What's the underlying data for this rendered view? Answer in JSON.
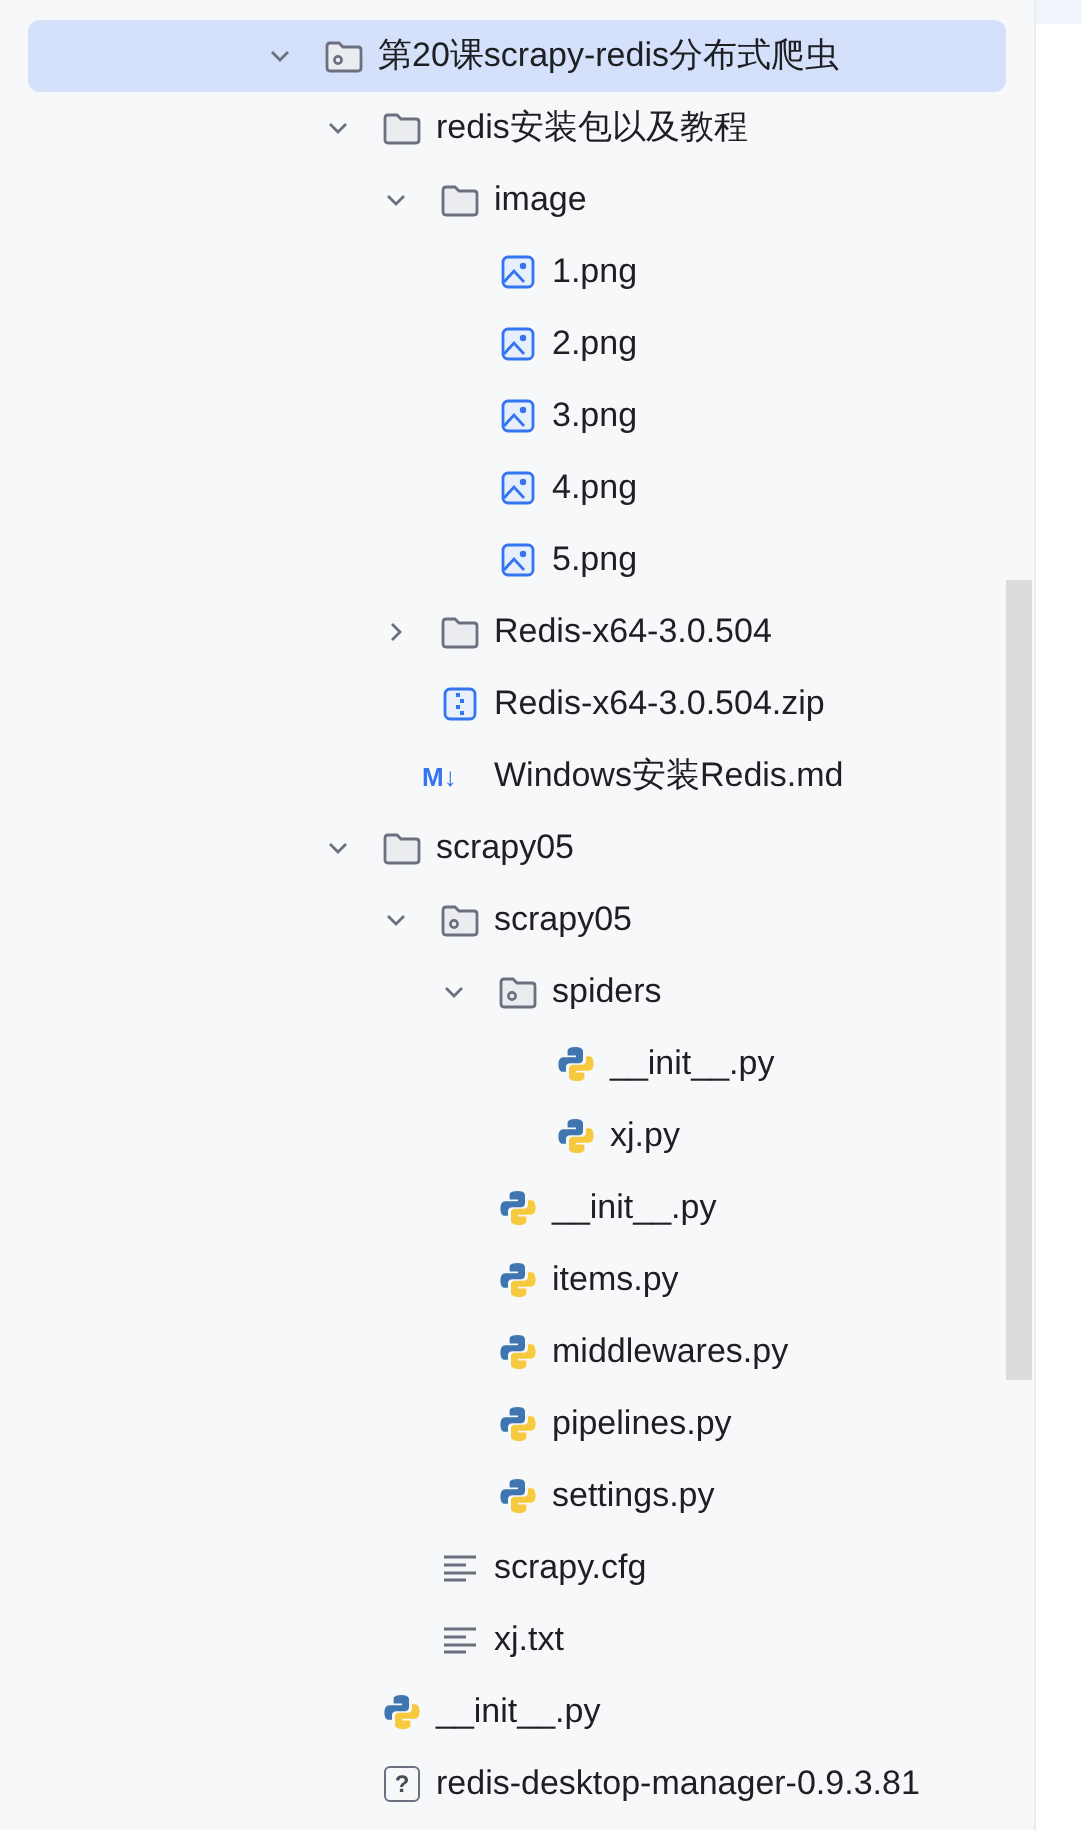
{
  "tree": [
    {
      "label": "第20课scrapy-redis分布式爬虫",
      "kind": "package",
      "selected": true,
      "expanded": true,
      "children": [
        {
          "label": "redis安装包以及教程",
          "kind": "folder",
          "selected": false,
          "expanded": true,
          "children": [
            {
              "label": "image",
              "kind": "folder",
              "selected": false,
              "expanded": true,
              "children": [
                {
                  "label": "1.png",
                  "kind": "image",
                  "selected": false
                },
                {
                  "label": "2.png",
                  "kind": "image",
                  "selected": false
                },
                {
                  "label": "3.png",
                  "kind": "image",
                  "selected": false
                },
                {
                  "label": "4.png",
                  "kind": "image",
                  "selected": false
                },
                {
                  "label": "5.png",
                  "kind": "image",
                  "selected": false
                }
              ]
            },
            {
              "label": "Redis-x64-3.0.504",
              "kind": "folder",
              "selected": false,
              "expanded": false
            },
            {
              "label": "Redis-x64-3.0.504.zip",
              "kind": "zip",
              "selected": false
            },
            {
              "label": "Windows安装Redis.md",
              "kind": "markdown",
              "badge": "M↓",
              "selected": false
            }
          ]
        },
        {
          "label": "scrapy05",
          "kind": "folder",
          "selected": false,
          "expanded": true,
          "children": [
            {
              "label": "scrapy05",
              "kind": "package",
              "selected": false,
              "expanded": true,
              "children": [
                {
                  "label": "spiders",
                  "kind": "package",
                  "selected": false,
                  "expanded": true,
                  "children": [
                    {
                      "label": "__init__.py",
                      "kind": "python",
                      "selected": false
                    },
                    {
                      "label": "xj.py",
                      "kind": "python",
                      "selected": false
                    }
                  ]
                },
                {
                  "label": "__init__.py",
                  "kind": "python",
                  "selected": false
                },
                {
                  "label": "items.py",
                  "kind": "python",
                  "selected": false
                },
                {
                  "label": "middlewares.py",
                  "kind": "python",
                  "selected": false
                },
                {
                  "label": "pipelines.py",
                  "kind": "python",
                  "selected": false
                },
                {
                  "label": "settings.py",
                  "kind": "python",
                  "selected": false
                }
              ]
            },
            {
              "label": "scrapy.cfg",
              "kind": "text",
              "selected": false
            },
            {
              "label": "xj.txt",
              "kind": "text",
              "selected": false
            }
          ]
        },
        {
          "label": "__init__.py",
          "kind": "python",
          "selected": false
        },
        {
          "label": "redis-desktop-manager-0.9.3.81",
          "kind": "unknown",
          "badge": "?",
          "selected": false
        }
      ]
    }
  ]
}
